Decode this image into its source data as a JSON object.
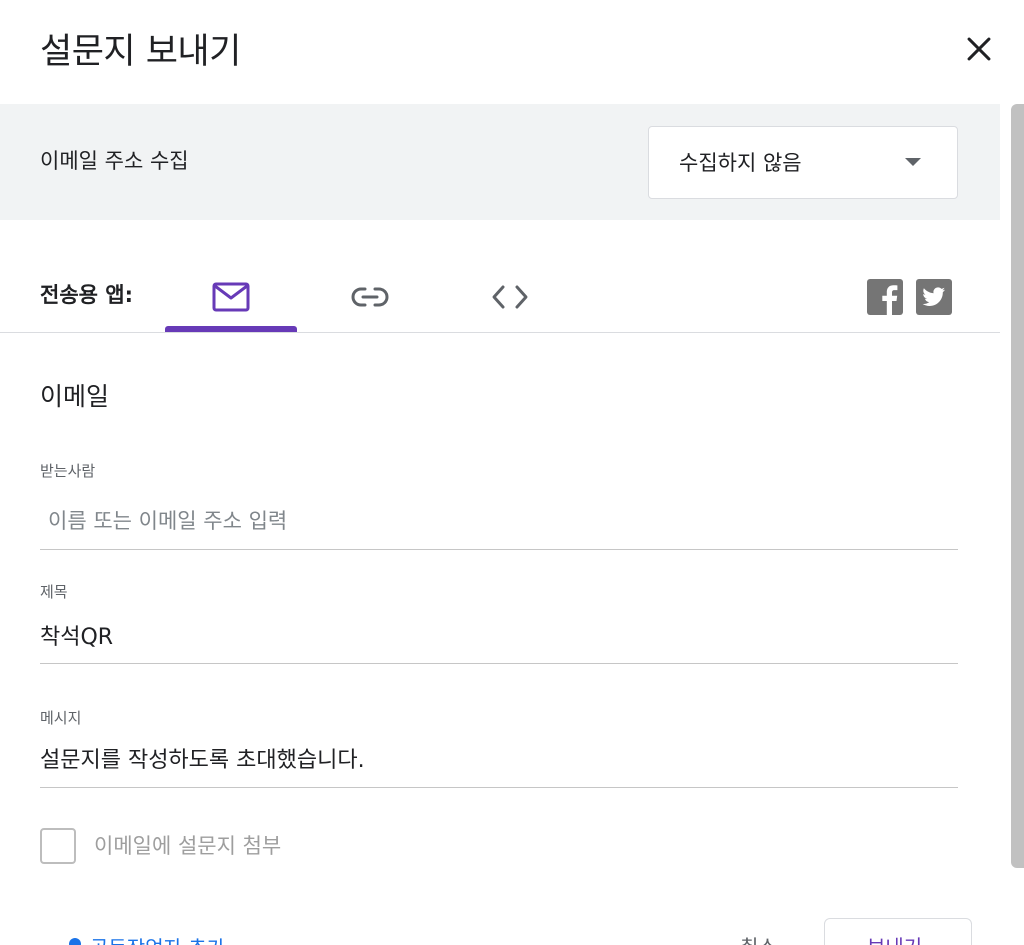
{
  "dialog": {
    "title": "설문지 보내기",
    "close_icon": "close-icon"
  },
  "collect_email": {
    "label": "이메일 주소 수집",
    "selected": "수집하지 않음",
    "arrow_icon": "dropdown-arrow-icon"
  },
  "send_via": {
    "label": "전송용 앱:",
    "tabs": [
      {
        "icon": "mail-icon",
        "active": true
      },
      {
        "icon": "link-icon",
        "active": false
      },
      {
        "icon": "embed-code-icon",
        "active": false
      }
    ],
    "social": [
      {
        "icon": "facebook-icon"
      },
      {
        "icon": "twitter-icon"
      }
    ]
  },
  "email": {
    "section_title": "이메일",
    "to_label": "받는사람",
    "to_placeholder": "이름 또는 이메일 주소 입력",
    "subject_label": "제목",
    "subject_value": "착석QR",
    "message_label": "메시지",
    "message_value": "설문지를 작성하도록 초대했습니다.",
    "attach_label": "이메일에 설문지 첨부"
  },
  "footer": {
    "fragment_text": "공동작업자 추가",
    "cancel_label": "취소",
    "send_label": "보내기"
  },
  "colors": {
    "accent": "#673ab7",
    "bar_bg": "#f1f3f4",
    "icon_gray": "#5f6368",
    "social_gray": "#757575"
  }
}
